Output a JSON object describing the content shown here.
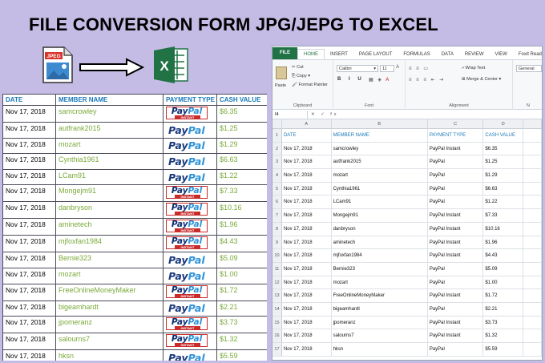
{
  "title": "FILE CONVERSION FORM JPG/JEPG TO EXCEL",
  "jpg_icon_label": "JPEG",
  "excel_icon_letter": "X",
  "left_table": {
    "headers": [
      "DATE",
      "MEMBER NAME",
      "PAYMENT TYPE",
      "CASH VALUE"
    ],
    "rows": [
      {
        "date": "Nov 17, 2018",
        "member": "samcrowley",
        "type": "instant",
        "cash": "$6.35"
      },
      {
        "date": "Nov 17, 2018",
        "member": "autfrank2015",
        "type": "plain",
        "cash": "$1.25"
      },
      {
        "date": "Nov 17, 2018",
        "member": "mozart",
        "type": "plain",
        "cash": "$1.29"
      },
      {
        "date": "Nov 17, 2018",
        "member": "Cynthia1961",
        "type": "plain",
        "cash": "$6.63"
      },
      {
        "date": "Nov 17, 2018",
        "member": "LCam91",
        "type": "plain",
        "cash": "$1.22"
      },
      {
        "date": "Nov 17, 2018",
        "member": "Mongejm91",
        "type": "instant",
        "cash": "$7.33"
      },
      {
        "date": "Nov 17, 2018",
        "member": "danbryson",
        "type": "instant",
        "cash": "$10.16"
      },
      {
        "date": "Nov 17, 2018",
        "member": "aminetech",
        "type": "instant",
        "cash": "$1.96"
      },
      {
        "date": "Nov 17, 2018",
        "member": "mjfoxfan1984",
        "type": "instant",
        "cash": "$4.43"
      },
      {
        "date": "Nov 17, 2018",
        "member": "Bernie323",
        "type": "plain",
        "cash": "$5.09"
      },
      {
        "date": "Nov 17, 2018",
        "member": "mozart",
        "type": "plain",
        "cash": "$1.00"
      },
      {
        "date": "Nov 17, 2018",
        "member": "FreeOnlineMoneyMaker",
        "type": "instant",
        "cash": "$1.72"
      },
      {
        "date": "Nov 17, 2018",
        "member": "bigeamhardt",
        "type": "plain",
        "cash": "$2.21"
      },
      {
        "date": "Nov 17, 2018",
        "member": "jpomeranz",
        "type": "instant",
        "cash": "$3.73"
      },
      {
        "date": "Nov 17, 2018",
        "member": "salourns7",
        "type": "instant",
        "cash": "$1.32"
      },
      {
        "date": "Nov 17, 2018",
        "member": "hksn",
        "type": "plain",
        "cash": "$5.59"
      }
    ],
    "paypal_logo_pay": "Pay",
    "paypal_logo_pal": "Pal",
    "paypal_instant_badge": "INSTANT"
  },
  "excel": {
    "tabs": [
      "FILE",
      "HOME",
      "INSERT",
      "PAGE LAYOUT",
      "FORMULAS",
      "DATA",
      "REVIEW",
      "VIEW",
      "Foxit Reader PDF"
    ],
    "clipboard": {
      "paste": "Paste",
      "cut": "Cut",
      "copy": "Copy",
      "format_painter": "Format Painter",
      "label": "Clipboard"
    },
    "font": {
      "name": "Calibri",
      "size": "11",
      "label": "Font"
    },
    "alignment": {
      "wrap_text": "Wrap Text",
      "merge_center": "Merge & Center",
      "label": "Alignment"
    },
    "number": {
      "format": "General",
      "label": "N"
    },
    "name_box": "I4",
    "fx": "fx",
    "columns": [
      "A",
      "B",
      "C",
      "D"
    ],
    "header_row": [
      "DATE",
      "MEMBER NAME",
      "PAYMENT TYPE",
      "CASH VALUE"
    ],
    "rows": [
      [
        "Nov 17, 2018",
        "samcrowley",
        "PayPal Instant",
        "$6.35"
      ],
      [
        "Nov 17, 2018",
        "autfrank2015",
        "PayPal",
        "$1.25"
      ],
      [
        "Nov 17, 2018",
        "mozart",
        "PayPal",
        "$1.29"
      ],
      [
        "Nov 17, 2018",
        "Cynthia1961",
        "PayPal",
        "$6.63"
      ],
      [
        "Nov 17, 2018",
        "LCam91",
        "PayPal",
        "$1.22"
      ],
      [
        "Nov 17, 2018",
        "Mongejm91",
        "PayPal Instant",
        "$7.33"
      ],
      [
        "Nov 17, 2018",
        "danbryson",
        "PayPal Instant",
        "$10.16"
      ],
      [
        "Nov 17, 2018",
        "aminetech",
        "PayPal Instant",
        "$1.96"
      ],
      [
        "Nov 17, 2018",
        "mjfoxfan1984",
        "PayPal Instant",
        "$4.43"
      ],
      [
        "Nov 17, 2018",
        "Bernie323",
        "PayPal",
        "$5.09"
      ],
      [
        "Nov 17, 2018",
        "mozart",
        "PayPal",
        "$1.00"
      ],
      [
        "Nov 17, 2018",
        "FreeOnlineMoneyMaker",
        "PayPal Instant",
        "$1.72"
      ],
      [
        "Nov 17, 2018",
        "bigeamhardt",
        "PayPal",
        "$2.21"
      ],
      [
        "Nov 17, 2018",
        "jpomeranz",
        "PayPal Instant",
        "$3.73"
      ],
      [
        "Nov 17, 2018",
        "salourns7",
        "PayPal Instant",
        "$1.32"
      ],
      [
        "Nov 17, 2018",
        "hksn",
        "PayPal",
        "$5.59"
      ]
    ]
  },
  "colors": {
    "background": "#c4bce4",
    "excel_green": "#217346",
    "header_blue": "#1a78b8",
    "member_green": "#7aaa3a"
  }
}
